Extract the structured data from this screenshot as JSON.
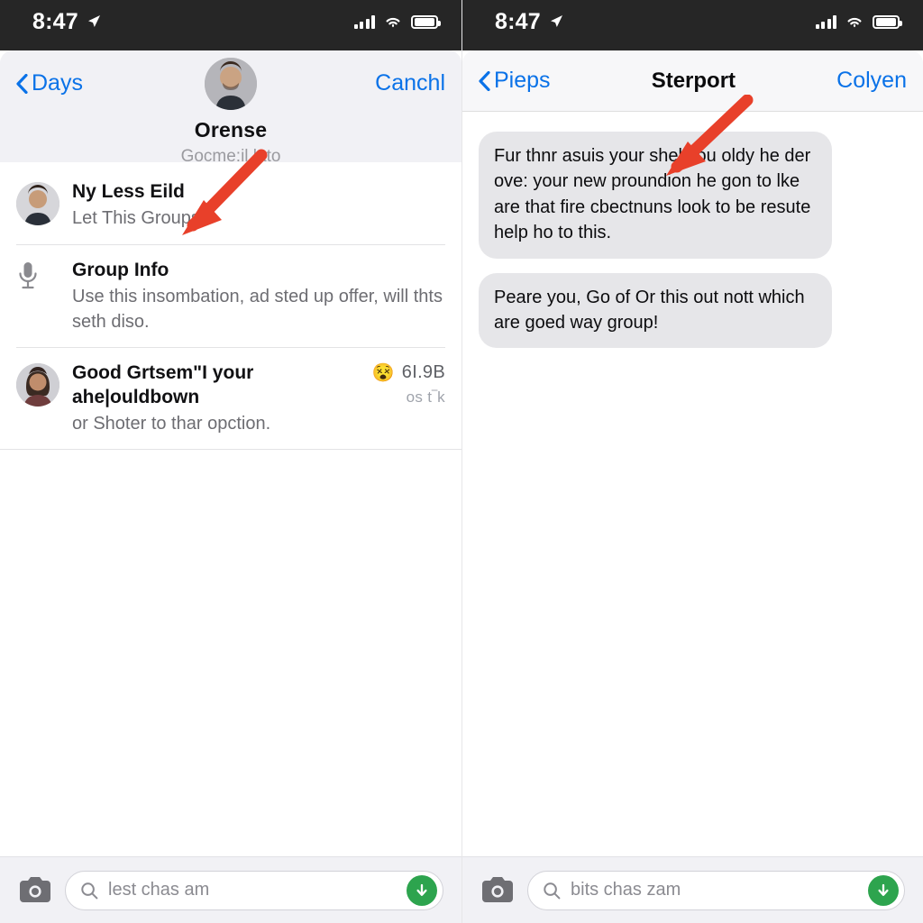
{
  "status_bar": {
    "time": "8:47",
    "location_icon": "location-arrow-icon",
    "signal_icon": "cellular-bars-icon",
    "wifi_icon": "wifi-icon",
    "battery_icon": "battery-icon"
  },
  "colors": {
    "accent_blue": "#0a72e8",
    "annotation_red": "#e8402a",
    "send_green": "#2da44e",
    "bubble_gray": "#e6e6e9",
    "header_gray": "#f1f1f5"
  },
  "left_panel": {
    "nav": {
      "back_label": "Days",
      "right_label": "Canchl",
      "contact_name": "Orense",
      "contact_subtitle": "Gocme:il lato"
    },
    "rows": [
      {
        "lead": "avatar-man",
        "title": "Ny Less Eild",
        "subtitle": "Let This Groups",
        "meta_top": "",
        "meta_bottom": "",
        "emoji": ""
      },
      {
        "lead": "microphone-icon",
        "title": "Group Info",
        "subtitle": "Use this insombation, ad sted up offer, will thts seth diso.",
        "meta_top": "",
        "meta_bottom": "",
        "emoji": ""
      },
      {
        "lead": "avatar-woman",
        "title": "Good Grtsem\"I your ahe|ouldbown",
        "subtitle": "or Shoter to thar opction.",
        "meta_top": "6I.9B",
        "meta_bottom": "ᴏs t‾k",
        "emoji": "😵"
      }
    ],
    "bottom_bar": {
      "camera_icon": "camera-icon",
      "search_icon": "search-icon",
      "search_value": "lest chas am",
      "search_placeholder": "lest chas am",
      "send_icon": "download-arrow-icon"
    }
  },
  "right_panel": {
    "nav": {
      "back_label": "Pieps",
      "title": "Sterport",
      "right_label": "Colyen"
    },
    "messages": [
      {
        "side": "incoming",
        "text": "Fur thnr asuis your shel you oldy he der ove: your new proundion he gon to lke are that fire cbectnuns look to be resute help ho to this."
      },
      {
        "side": "incoming",
        "text": "Peare you, Go of Or this out nott which are goed way group!"
      }
    ],
    "bottom_bar": {
      "camera_icon": "camera-icon",
      "search_icon": "search-icon",
      "search_value": "bits chas zam",
      "search_placeholder": "bits chas zam",
      "send_icon": "download-arrow-icon"
    }
  },
  "annotations": [
    {
      "name": "arrow-pointing-to-first-list-row",
      "color": "#e8402a"
    },
    {
      "name": "arrow-pointing-to-first-message-bubble",
      "color": "#e8402a"
    }
  ]
}
